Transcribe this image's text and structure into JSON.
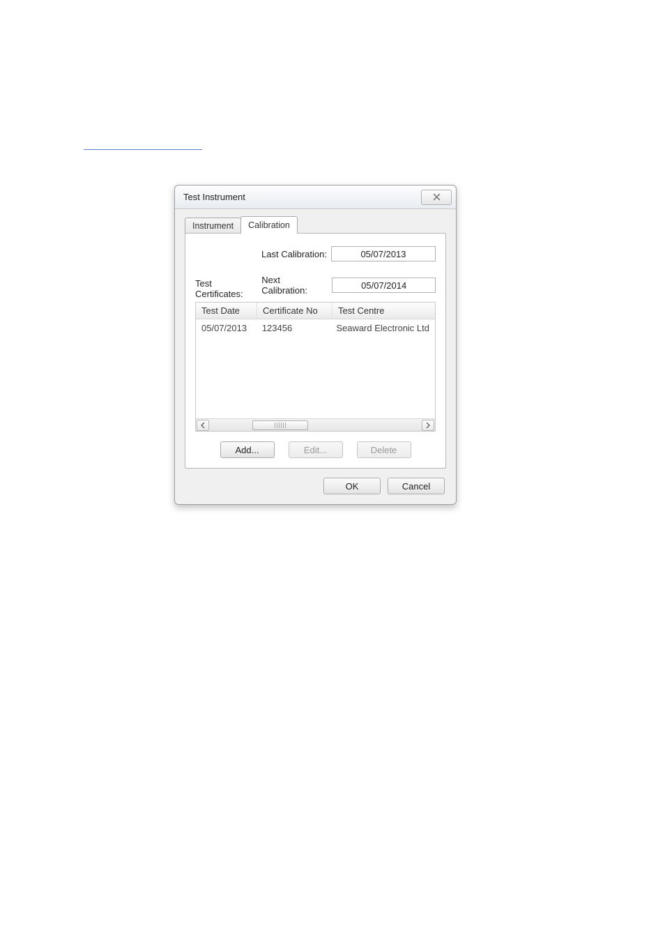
{
  "dialog": {
    "title": "Test Instrument",
    "tabs": {
      "instrument": "Instrument",
      "calibration": "Calibration"
    },
    "last_calibration_label": "Last Calibration:",
    "last_calibration_value": "05/07/2013",
    "next_calibration_label": "Next Calibration:",
    "next_calibration_value": "05/07/2014",
    "test_certificates_label": "Test Certificates:",
    "columns": {
      "test_date": "Test Date",
      "certificate_no": "Certificate No",
      "test_centre": "Test Centre"
    },
    "rows": [
      {
        "test_date": "05/07/2013",
        "certificate_no": "123456",
        "test_centre": "Seaward Electronic Ltd"
      }
    ],
    "buttons": {
      "add": "Add...",
      "edit": "Edit...",
      "delete": "Delete",
      "ok": "OK",
      "cancel": "Cancel"
    }
  }
}
